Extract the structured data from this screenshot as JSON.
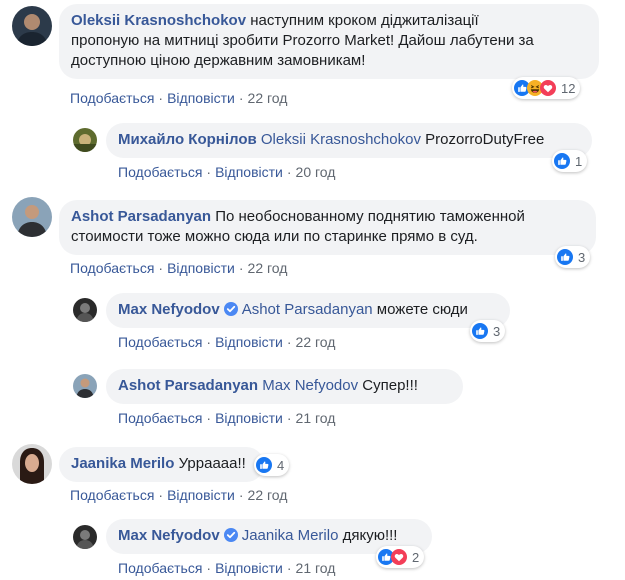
{
  "actions": {
    "like": "Подобається",
    "reply": "Відповісти",
    "sep": "·"
  },
  "comments": [
    {
      "author": "Oleksii Krasnoshchokov",
      "text_lines": [
        "наступним кроком діджиталізації",
        "пропоную на митниці зробити Prozorro Market! Дайош лабутени за",
        "доступною ціною державним замовникам!"
      ],
      "time": "22 год",
      "reaction_count": "12",
      "reactions": [
        "like-reaction-icon",
        "haha-reaction-icon",
        "love-reaction-icon"
      ]
    },
    {
      "author": "Михайло Корнілов",
      "mention": "Oleksii Krasnoshchokov",
      "text": "ProzorroDutyFree",
      "time": "20 год",
      "reaction_count": "1",
      "reactions": [
        "like-reaction-icon"
      ]
    },
    {
      "author": "Ashot Parsadanyan",
      "text_lines": [
        "По необоснованному поднятию таможенной",
        "стоимости тоже можно сюда или по старинке прямо в суд."
      ],
      "time": "22 год",
      "reaction_count": "3",
      "reactions": [
        "like-reaction-icon"
      ]
    },
    {
      "author": "Max Nefyodov",
      "verified": true,
      "mention": "Ashot Parsadanyan",
      "text": "можете сюди",
      "time": "22 год",
      "reaction_count": "3",
      "reactions": [
        "like-reaction-icon"
      ]
    },
    {
      "author": "Ashot Parsadanyan",
      "mention": "Max Nefyodov",
      "text": "Супер!!!",
      "time": "21 год"
    },
    {
      "author": "Jaanika Merilo",
      "text": "Урраааа!!",
      "time": "22 год",
      "reaction_count": "4",
      "reactions": [
        "like-reaction-icon"
      ]
    },
    {
      "author": "Max Nefyodov",
      "verified": true,
      "mention": "Jaanika Merilo",
      "text": "дякую!!!",
      "time": "21 год",
      "reaction_count": "2",
      "reactions": [
        "like-reaction-icon",
        "love-reaction-icon"
      ]
    }
  ],
  "colors": {
    "link": "#385898",
    "bubble": "#f2f3f5",
    "like": "#1877f2",
    "love": "#f33e58",
    "haha": "#f7b125"
  }
}
